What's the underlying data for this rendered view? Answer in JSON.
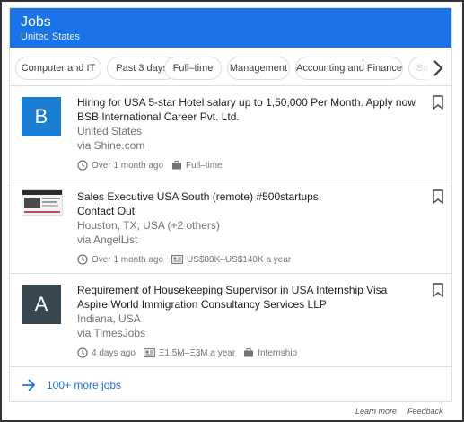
{
  "header": {
    "title": "Jobs",
    "subtitle": "United States"
  },
  "chips": [
    {
      "label": "Computer and IT"
    },
    {
      "label": "Past 3 days"
    },
    {
      "label": "Full–time"
    },
    {
      "label": "Management"
    },
    {
      "label": "Accounting and Finance"
    },
    {
      "label": "Sa"
    }
  ],
  "jobs": [
    {
      "logo_letter": "B",
      "logo_color": "#1a7fd0",
      "title": "Hiring for USA 5-star Hotel salary up to 1,50,000 Per Month. Apply now",
      "company": "BSB International Career Pvt. Ltd.",
      "location": "United States",
      "via": "via Shine.com",
      "posted": "Over 1 month ago",
      "type": "Full–time"
    },
    {
      "title": "Sales Executive USA South (remote) #500startups",
      "company": "Contact Out",
      "location": "Houston, TX, USA (+2 others)",
      "via": "via AngelList",
      "posted": "Over 1 month ago",
      "salary": "US$80K–US$140K a year"
    },
    {
      "logo_letter": "A",
      "logo_color": "#37474f",
      "title": "Requirement of Housekeeping Supervisor in USA Internship Visa",
      "company": "Aspire World Immigration Consultancy Services LLP",
      "location": "Indiana, USA",
      "via": "via TimesJobs",
      "posted": "4 days ago",
      "salary": "Ξ1.5M–Ξ3M a year",
      "type": "Internship"
    }
  ],
  "more": {
    "label": "100+ more jobs"
  },
  "footer": {
    "learn_more": "Learn more",
    "feedback": "Feedback"
  },
  "colors": {
    "accent": "#1a73e8",
    "muted": "#70757a"
  }
}
